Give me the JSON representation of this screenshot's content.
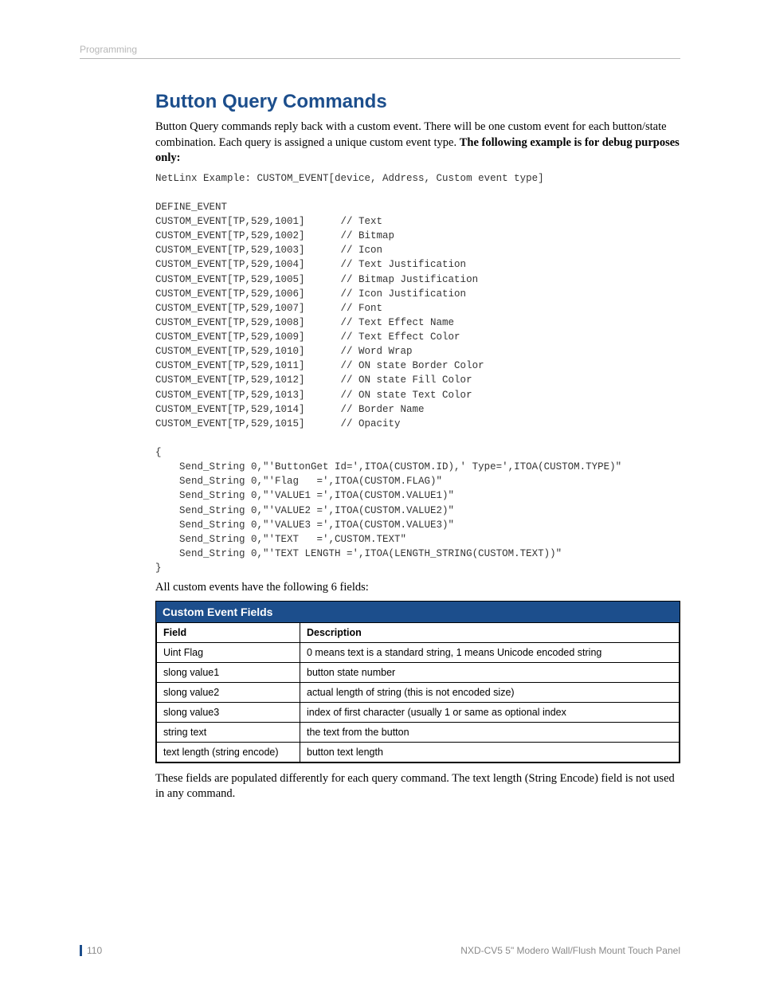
{
  "header": {
    "section": "Programming"
  },
  "title": "Button Query Commands",
  "intro": {
    "p1a": "Button Query commands reply back with a custom event. There will be one custom event for each button/state combination. Each query is assigned a unique custom event type. ",
    "p1b": "The following example is for debug purposes only:"
  },
  "code": "NetLinx Example: CUSTOM_EVENT[device, Address, Custom event type]\n\nDEFINE_EVENT\nCUSTOM_EVENT[TP,529,1001]      // Text\nCUSTOM_EVENT[TP,529,1002]      // Bitmap\nCUSTOM_EVENT[TP,529,1003]      // Icon\nCUSTOM_EVENT[TP,529,1004]      // Text Justification\nCUSTOM_EVENT[TP,529,1005]      // Bitmap Justification\nCUSTOM_EVENT[TP,529,1006]      // Icon Justification\nCUSTOM_EVENT[TP,529,1007]      // Font\nCUSTOM_EVENT[TP,529,1008]      // Text Effect Name\nCUSTOM_EVENT[TP,529,1009]      // Text Effect Color\nCUSTOM_EVENT[TP,529,1010]      // Word Wrap\nCUSTOM_EVENT[TP,529,1011]      // ON state Border Color\nCUSTOM_EVENT[TP,529,1012]      // ON state Fill Color\nCUSTOM_EVENT[TP,529,1013]      // ON state Text Color\nCUSTOM_EVENT[TP,529,1014]      // Border Name\nCUSTOM_EVENT[TP,529,1015]      // Opacity\n\n{\n    Send_String 0,\"'ButtonGet Id=',ITOA(CUSTOM.ID),' Type=',ITOA(CUSTOM.TYPE)\"\n    Send_String 0,\"'Flag   =',ITOA(CUSTOM.FLAG)\"\n    Send_String 0,\"'VALUE1 =',ITOA(CUSTOM.VALUE1)\"\n    Send_String 0,\"'VALUE2 =',ITOA(CUSTOM.VALUE2)\"\n    Send_String 0,\"'VALUE3 =',ITOA(CUSTOM.VALUE3)\"\n    Send_String 0,\"'TEXT   =',CUSTOM.TEXT\"\n    Send_String 0,\"'TEXT LENGTH =',ITOA(LENGTH_STRING(CUSTOM.TEXT))\"\n}",
  "after_code": "All custom events have the following 6 fields:",
  "table": {
    "title": "Custom Event Fields",
    "head": {
      "field": "Field",
      "desc": "Description"
    },
    "rows": [
      {
        "field": "Uint Flag",
        "desc": "0 means text is a standard string, 1 means Unicode encoded string"
      },
      {
        "field": "slong value1",
        "desc": "button state number"
      },
      {
        "field": "slong value2",
        "desc": "actual length of string (this is not encoded size)"
      },
      {
        "field": "slong value3",
        "desc": "index of first character (usually 1 or same as optional index"
      },
      {
        "field": "string text",
        "desc": "the text from the button"
      },
      {
        "field": "text length (string encode)",
        "desc": "button text length"
      }
    ]
  },
  "closing": "These fields are populated differently for each query command. The text length (String Encode) field is not used in any command.",
  "footer": {
    "page": "110",
    "product": "NXD-CV5 5\" Modero Wall/Flush Mount Touch Panel"
  }
}
